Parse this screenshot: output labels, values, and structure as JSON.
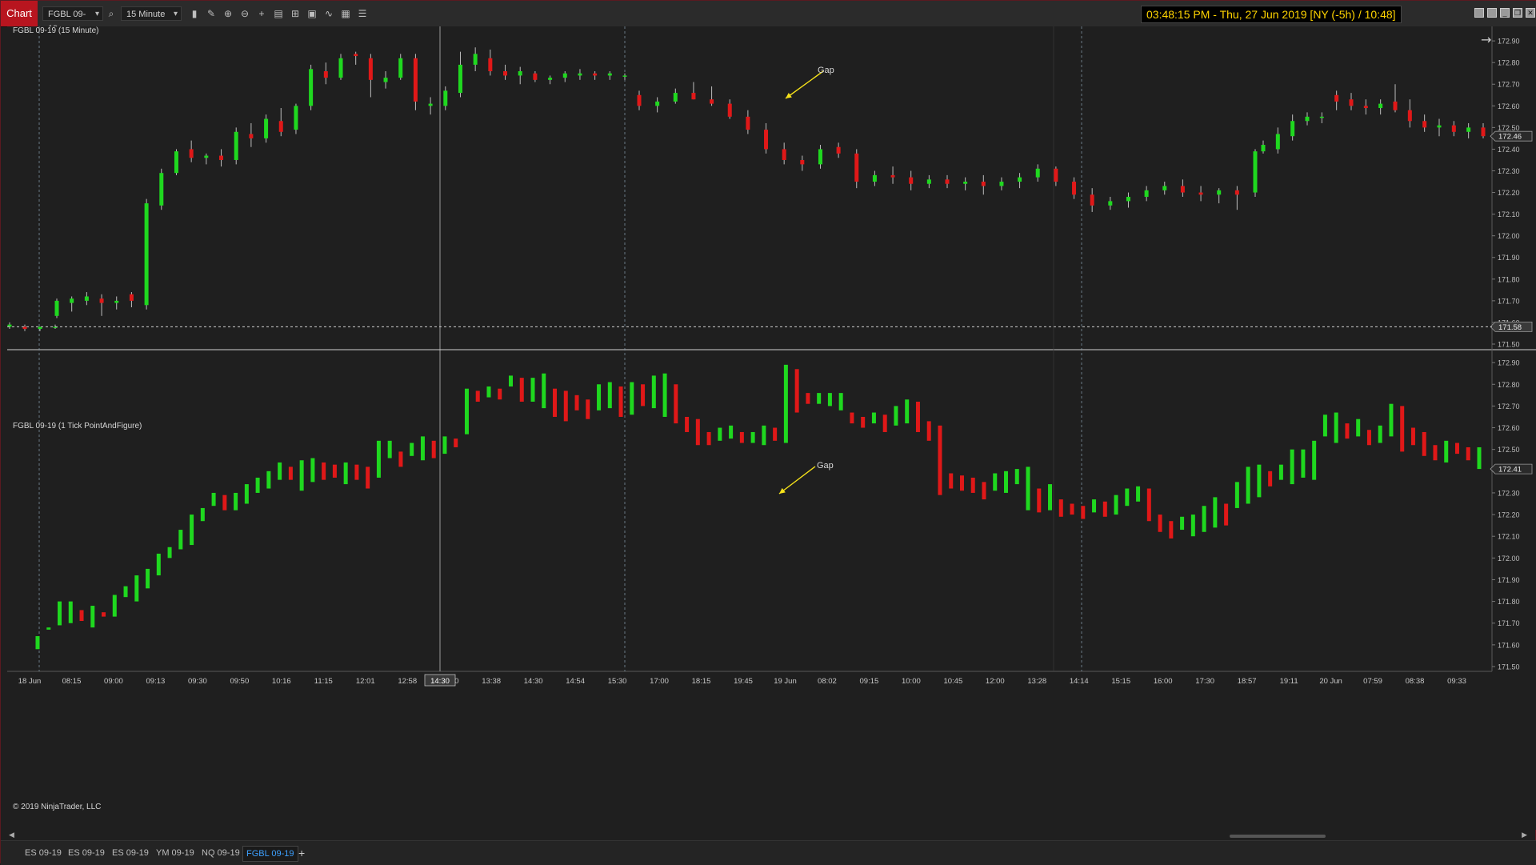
{
  "toolbar": {
    "chart_tab": "Chart",
    "instrument": "FGBL 09-19",
    "interval": "15 Minute",
    "clock": "03:48:15 PM - Thu, 27 Jun 2019 [NY (-5h) / 10:48]",
    "icons": [
      "search-icon",
      "bar-style-icon",
      "draw-icon",
      "zoom-in-icon",
      "zoom-out-icon",
      "crosshair-icon",
      "properties-icon",
      "indicators-icon",
      "strategies-icon",
      "scale-icon",
      "performance-icon",
      "list-icon"
    ]
  },
  "panels": [
    {
      "label": "FGBL 09-19 (15 Minute)",
      "last_price": "172.46",
      "crosshair_price": "171.58",
      "annotation": "Gap"
    },
    {
      "label": "FGBL 09-19 (1 Tick PointAndFigure)",
      "last_price": "172.41",
      "annotation": "Gap"
    }
  ],
  "price_axis": [
    "172.90",
    "172.80",
    "172.70",
    "172.60",
    "172.50",
    "172.40",
    "172.30",
    "172.20",
    "172.10",
    "172.00",
    "171.90",
    "171.80",
    "171.70",
    "171.60",
    "171.50"
  ],
  "time_axis": [
    "18 Jun",
    "08:15",
    "09:00",
    "09:13",
    "09:30",
    "09:50",
    "10:16",
    "11:15",
    "12:01",
    "12:58",
    "13:30",
    "13:38",
    "14:30",
    "14:54",
    "15:30",
    "17:00",
    "18:15",
    "19:45",
    "19 Jun",
    "08:02",
    "09:15",
    "10:00",
    "10:45",
    "12:00",
    "13:28",
    "14:14",
    "15:15",
    "16:00",
    "17:30",
    "18:57",
    "19:11",
    "20 Jun",
    "07:59",
    "08:38",
    "09:33"
  ],
  "crosshair_time": "14:30",
  "copyright": "© 2019 NinjaTrader, LLC",
  "instrument_tabs": [
    "ES 09-19",
    "ES 09-19",
    "ES 09-19",
    "YM 09-19",
    "NQ 09-19",
    "FGBL 09-19"
  ],
  "active_tab": "FGBL 09-19",
  "colors": {
    "up": "#1fd81f",
    "down": "#e01818",
    "annotation": "#f5e11a",
    "background": "#1f1f1f"
  },
  "chart_data": [
    {
      "type": "candlestick",
      "title": "FGBL 09-19 (15 Minute)",
      "ylim": [
        171.5,
        172.93
      ],
      "y_ticks": [
        172.9,
        172.8,
        172.7,
        172.6,
        172.5,
        172.4,
        172.3,
        172.2,
        172.1,
        172.0,
        171.9,
        171.8,
        171.7,
        171.6,
        171.5
      ],
      "x_labels": [
        "18 Jun",
        "08:15",
        "09:00",
        "09:13",
        "09:30",
        "09:50",
        "10:16",
        "11:15",
        "12:01",
        "12:58",
        "13:30",
        "13:38",
        "14:30",
        "14:54",
        "15:30",
        "17:00",
        "18:15",
        "19:45",
        "19 Jun",
        "08:02",
        "09:15",
        "10:00",
        "10:45",
        "12:00",
        "13:28",
        "14:14",
        "15:15",
        "16:00",
        "17:30",
        "18:57",
        "19:11",
        "20 Jun",
        "07:59",
        "08:38",
        "09:33"
      ],
      "last_price": 172.46,
      "ohlc": [
        [
          171.58,
          171.6,
          171.57,
          171.59
        ],
        [
          171.58,
          171.59,
          171.56,
          171.57
        ],
        [
          171.57,
          171.58,
          171.56,
          171.58
        ],
        [
          171.58,
          171.59,
          171.57,
          171.58
        ],
        [
          171.63,
          171.71,
          171.62,
          171.7
        ],
        [
          171.69,
          171.72,
          171.65,
          171.71
        ],
        [
          171.7,
          171.74,
          171.68,
          171.72
        ],
        [
          171.71,
          171.73,
          171.63,
          171.69
        ],
        [
          171.69,
          171.72,
          171.66,
          171.7
        ],
        [
          171.73,
          171.74,
          171.67,
          171.7
        ],
        [
          171.68,
          172.17,
          171.66,
          172.15
        ],
        [
          172.14,
          172.31,
          172.12,
          172.29
        ],
        [
          172.29,
          172.4,
          172.28,
          172.39
        ],
        [
          172.4,
          172.44,
          172.34,
          172.36
        ],
        [
          172.36,
          172.38,
          172.33,
          172.37
        ],
        [
          172.37,
          172.4,
          172.32,
          172.35
        ],
        [
          172.35,
          172.5,
          172.33,
          172.48
        ],
        [
          172.47,
          172.52,
          172.41,
          172.45
        ],
        [
          172.45,
          172.56,
          172.43,
          172.54
        ],
        [
          172.53,
          172.59,
          172.46,
          172.48
        ],
        [
          172.49,
          172.61,
          172.47,
          172.6
        ],
        [
          172.6,
          172.79,
          172.58,
          172.77
        ],
        [
          172.76,
          172.8,
          172.7,
          172.73
        ],
        [
          172.73,
          172.84,
          172.72,
          172.82
        ],
        [
          172.84,
          172.85,
          172.79,
          172.83
        ],
        [
          172.82,
          172.84,
          172.64,
          172.72
        ],
        [
          172.71,
          172.76,
          172.68,
          172.73
        ],
        [
          172.73,
          172.84,
          172.72,
          172.82
        ],
        [
          172.82,
          172.84,
          172.58,
          172.62
        ],
        [
          172.6,
          172.64,
          172.56,
          172.61
        ],
        [
          172.6,
          172.69,
          172.58,
          172.67
        ],
        [
          172.66,
          172.85,
          172.64,
          172.79
        ],
        [
          172.79,
          172.87,
          172.76,
          172.84
        ],
        [
          172.82,
          172.86,
          172.74,
          172.76
        ],
        [
          172.76,
          172.79,
          172.72,
          172.74
        ],
        [
          172.74,
          172.78,
          172.7,
          172.76
        ],
        [
          172.75,
          172.76,
          172.71,
          172.72
        ],
        [
          172.72,
          172.74,
          172.7,
          172.73
        ],
        [
          172.73,
          172.76,
          172.71,
          172.75
        ],
        [
          172.74,
          172.77,
          172.72,
          172.75
        ],
        [
          172.75,
          172.76,
          172.72,
          172.74
        ],
        [
          172.74,
          172.76,
          172.72,
          172.75
        ],
        [
          172.74,
          172.75,
          172.72,
          172.74
        ],
        [
          172.65,
          172.67,
          172.58,
          172.6
        ],
        [
          172.6,
          172.64,
          172.57,
          172.62
        ],
        [
          172.62,
          172.68,
          172.61,
          172.66
        ],
        [
          172.66,
          172.71,
          172.63,
          172.63
        ],
        [
          172.63,
          172.69,
          172.6,
          172.61
        ],
        [
          172.61,
          172.63,
          172.54,
          172.55
        ],
        [
          172.55,
          172.58,
          172.47,
          172.49
        ],
        [
          172.49,
          172.52,
          172.38,
          172.4
        ],
        [
          172.4,
          172.43,
          172.33,
          172.35
        ],
        [
          172.35,
          172.37,
          172.3,
          172.33
        ],
        [
          172.33,
          172.42,
          172.31,
          172.4
        ],
        [
          172.41,
          172.43,
          172.36,
          172.38
        ],
        [
          172.38,
          172.4,
          172.22,
          172.25
        ],
        [
          172.25,
          172.3,
          172.23,
          172.28
        ],
        [
          172.28,
          172.32,
          172.24,
          172.27
        ],
        [
          172.27,
          172.3,
          172.21,
          172.24
        ],
        [
          172.24,
          172.28,
          172.22,
          172.26
        ],
        [
          172.26,
          172.28,
          172.22,
          172.24
        ],
        [
          172.24,
          172.27,
          172.21,
          172.25
        ],
        [
          172.25,
          172.28,
          172.19,
          172.23
        ],
        [
          172.23,
          172.27,
          172.21,
          172.25
        ],
        [
          172.25,
          172.29,
          172.22,
          172.27
        ],
        [
          172.27,
          172.33,
          172.25,
          172.31
        ],
        [
          172.31,
          172.32,
          172.23,
          172.25
        ],
        [
          172.25,
          172.27,
          172.17,
          172.19
        ],
        [
          172.19,
          172.22,
          172.11,
          172.14
        ],
        [
          172.14,
          172.18,
          172.12,
          172.16
        ],
        [
          172.16,
          172.2,
          172.13,
          172.18
        ],
        [
          172.18,
          172.23,
          172.16,
          172.21
        ],
        [
          172.21,
          172.25,
          172.19,
          172.23
        ],
        [
          172.23,
          172.26,
          172.18,
          172.2
        ],
        [
          172.2,
          172.23,
          172.16,
          172.19
        ],
        [
          172.19,
          172.22,
          172.15,
          172.21
        ],
        [
          172.21,
          172.23,
          172.12,
          172.19
        ],
        [
          172.2,
          172.4,
          172.18,
          172.39
        ],
        [
          172.39,
          172.44,
          172.38,
          172.42
        ],
        [
          172.4,
          172.5,
          172.38,
          172.47
        ],
        [
          172.46,
          172.56,
          172.44,
          172.53
        ],
        [
          172.53,
          172.57,
          172.51,
          172.55
        ],
        [
          172.55,
          172.57,
          172.52,
          172.55
        ],
        [
          172.65,
          172.67,
          172.58,
          172.62
        ],
        [
          172.63,
          172.66,
          172.58,
          172.6
        ],
        [
          172.6,
          172.63,
          172.56,
          172.59
        ],
        [
          172.59,
          172.63,
          172.56,
          172.61
        ],
        [
          172.62,
          172.7,
          172.57,
          172.58
        ],
        [
          172.58,
          172.63,
          172.5,
          172.53
        ],
        [
          172.53,
          172.56,
          172.48,
          172.5
        ],
        [
          172.5,
          172.54,
          172.46,
          172.51
        ],
        [
          172.51,
          172.53,
          172.46,
          172.48
        ],
        [
          172.48,
          172.52,
          172.45,
          172.5
        ],
        [
          172.5,
          172.52,
          172.45,
          172.46
        ]
      ]
    },
    {
      "type": "point-and-figure",
      "title": "FGBL 09-19 (1 Tick PointAndFigure)",
      "ylim": [
        171.5,
        172.93
      ],
      "y_ticks": [
        172.9,
        172.8,
        172.7,
        172.6,
        172.5,
        172.4,
        172.3,
        172.2,
        172.1,
        172.0,
        171.9,
        171.8,
        171.7,
        171.6,
        171.5
      ],
      "last_price": 172.41,
      "columns": [
        [
          171.58,
          171.64
        ],
        [
          171.67,
          171.68
        ],
        [
          171.69,
          171.8
        ],
        [
          171.7,
          171.8
        ],
        [
          171.71,
          171.76
        ],
        [
          171.68,
          171.78
        ],
        [
          171.73,
          171.75
        ],
        [
          171.73,
          171.83
        ],
        [
          171.82,
          171.87
        ],
        [
          171.8,
          171.92
        ],
        [
          171.86,
          171.95
        ],
        [
          171.92,
          172.02
        ],
        [
          172.0,
          172.05
        ],
        [
          172.04,
          172.13
        ],
        [
          172.06,
          172.2
        ],
        [
          172.17,
          172.23
        ],
        [
          172.24,
          172.3
        ],
        [
          172.22,
          172.29
        ],
        [
          172.22,
          172.3
        ],
        [
          172.25,
          172.34
        ],
        [
          172.3,
          172.37
        ],
        [
          172.32,
          172.4
        ],
        [
          172.36,
          172.44
        ],
        [
          172.36,
          172.42
        ],
        [
          172.31,
          172.45
        ],
        [
          172.35,
          172.46
        ],
        [
          172.36,
          172.44
        ],
        [
          172.37,
          172.43
        ],
        [
          172.34,
          172.44
        ],
        [
          172.36,
          172.43
        ],
        [
          172.32,
          172.42
        ],
        [
          172.37,
          172.54
        ],
        [
          172.46,
          172.54
        ],
        [
          172.42,
          172.49
        ],
        [
          172.47,
          172.53
        ],
        [
          172.45,
          172.56
        ],
        [
          172.46,
          172.54
        ],
        [
          172.48,
          172.56
        ],
        [
          172.51,
          172.55
        ],
        [
          172.57,
          172.78
        ],
        [
          172.72,
          172.77
        ],
        [
          172.74,
          172.79
        ],
        [
          172.73,
          172.78
        ],
        [
          172.79,
          172.84
        ],
        [
          172.72,
          172.83
        ],
        [
          172.72,
          172.83
        ],
        [
          172.69,
          172.85
        ],
        [
          172.65,
          172.78
        ],
        [
          172.63,
          172.77
        ],
        [
          172.68,
          172.75
        ],
        [
          172.64,
          172.73
        ],
        [
          172.68,
          172.8
        ],
        [
          172.69,
          172.81
        ],
        [
          172.65,
          172.79
        ],
        [
          172.66,
          172.81
        ],
        [
          172.7,
          172.8
        ],
        [
          172.69,
          172.84
        ],
        [
          172.65,
          172.85
        ],
        [
          172.62,
          172.8
        ],
        [
          172.58,
          172.65
        ],
        [
          172.52,
          172.64
        ],
        [
          172.52,
          172.58
        ],
        [
          172.54,
          172.6
        ],
        [
          172.55,
          172.61
        ],
        [
          172.53,
          172.58
        ],
        [
          172.53,
          172.58
        ],
        [
          172.52,
          172.61
        ],
        [
          172.54,
          172.6
        ],
        [
          172.53,
          172.89
        ],
        [
          172.67,
          172.87
        ],
        [
          172.71,
          172.76
        ],
        [
          172.71,
          172.76
        ],
        [
          172.7,
          172.76
        ],
        [
          172.68,
          172.76
        ],
        [
          172.62,
          172.67
        ],
        [
          172.6,
          172.65
        ],
        [
          172.62,
          172.67
        ],
        [
          172.58,
          172.66
        ],
        [
          172.61,
          172.7
        ],
        [
          172.62,
          172.73
        ],
        [
          172.58,
          172.72
        ],
        [
          172.54,
          172.63
        ],
        [
          172.29,
          172.61
        ],
        [
          172.32,
          172.39
        ],
        [
          172.31,
          172.38
        ],
        [
          172.3,
          172.37
        ],
        [
          172.27,
          172.35
        ],
        [
          172.31,
          172.39
        ],
        [
          172.3,
          172.4
        ],
        [
          172.34,
          172.41
        ],
        [
          172.22,
          172.42
        ],
        [
          172.21,
          172.32
        ],
        [
          172.22,
          172.34
        ],
        [
          172.19,
          172.27
        ],
        [
          172.2,
          172.25
        ],
        [
          172.18,
          172.24
        ],
        [
          172.21,
          172.27
        ],
        [
          172.19,
          172.26
        ],
        [
          172.2,
          172.29
        ],
        [
          172.24,
          172.32
        ],
        [
          172.26,
          172.33
        ],
        [
          172.17,
          172.32
        ],
        [
          172.12,
          172.2
        ],
        [
          172.09,
          172.17
        ],
        [
          172.13,
          172.19
        ],
        [
          172.1,
          172.2
        ],
        [
          172.12,
          172.24
        ],
        [
          172.14,
          172.28
        ],
        [
          172.15,
          172.25
        ],
        [
          172.23,
          172.35
        ],
        [
          172.25,
          172.42
        ],
        [
          172.28,
          172.43
        ],
        [
          172.33,
          172.4
        ],
        [
          172.36,
          172.43
        ],
        [
          172.34,
          172.5
        ],
        [
          172.37,
          172.5
        ],
        [
          172.36,
          172.54
        ],
        [
          172.56,
          172.66
        ],
        [
          172.53,
          172.67
        ],
        [
          172.55,
          172.62
        ],
        [
          172.56,
          172.64
        ],
        [
          172.52,
          172.59
        ],
        [
          172.53,
          172.61
        ],
        [
          172.56,
          172.71
        ],
        [
          172.49,
          172.7
        ],
        [
          172.52,
          172.6
        ],
        [
          172.47,
          172.58
        ],
        [
          172.45,
          172.52
        ],
        [
          172.44,
          172.54
        ],
        [
          172.48,
          172.53
        ],
        [
          172.45,
          172.51
        ],
        [
          172.41,
          172.51
        ]
      ]
    }
  ]
}
